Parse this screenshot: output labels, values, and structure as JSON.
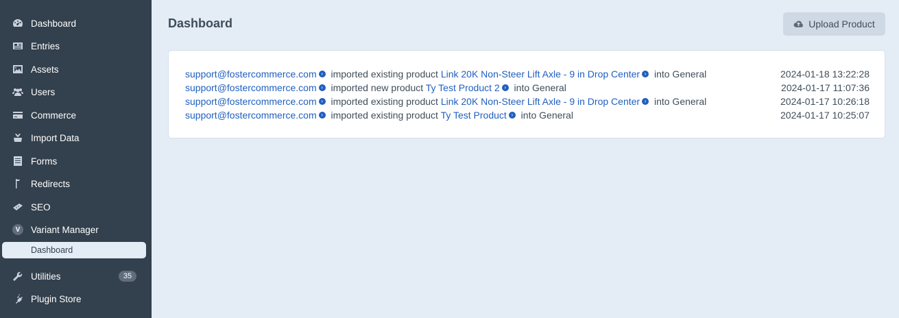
{
  "sidebar": {
    "items": [
      {
        "label": "Dashboard",
        "icon": "gauge-icon"
      },
      {
        "label": "Entries",
        "icon": "newspaper-icon"
      },
      {
        "label": "Assets",
        "icon": "image-icon"
      },
      {
        "label": "Users",
        "icon": "users-icon"
      },
      {
        "label": "Commerce",
        "icon": "credit-card-icon"
      },
      {
        "label": "Import Data",
        "icon": "import-icon"
      },
      {
        "label": "Forms",
        "icon": "form-icon"
      },
      {
        "label": "Redirects",
        "icon": "signpost-icon"
      },
      {
        "label": "SEO",
        "icon": "seo-icon"
      },
      {
        "label": "Variant Manager",
        "icon": "v-icon",
        "icon_letter": "V"
      },
      {
        "label": "Utilities",
        "icon": "wrench-icon",
        "badge": "35"
      },
      {
        "label": "Plugin Store",
        "icon": "plug-icon"
      }
    ],
    "sub_item": {
      "label": "Dashboard"
    }
  },
  "main": {
    "title": "Dashboard",
    "upload_button": "Upload Product",
    "log": [
      {
        "user": "support@fostercommerce.com",
        "action": "imported existing product",
        "product": "Link 20K Non-Steer Lift Axle - 9 in Drop Center",
        "suffix": "into General",
        "timestamp": "2024-01-18 13:22:28"
      },
      {
        "user": "support@fostercommerce.com",
        "action": "imported new product",
        "product": "Ty Test Product 2",
        "suffix": "into General",
        "timestamp": "2024-01-17 11:07:36"
      },
      {
        "user": "support@fostercommerce.com",
        "action": "imported existing product",
        "product": "Link 20K Non-Steer Lift Axle - 9 in Drop Center",
        "suffix": "into General",
        "timestamp": "2024-01-17 10:26:18"
      },
      {
        "user": "support@fostercommerce.com",
        "action": "imported existing product",
        "product": "Ty Test Product",
        "suffix": "into General",
        "timestamp": "2024-01-17 10:25:07"
      }
    ]
  },
  "colors": {
    "sidebar_bg": "#33404d",
    "page_bg": "#e4ecf6",
    "link": "#1f5fbf",
    "badge_bg": "#606d7b"
  }
}
